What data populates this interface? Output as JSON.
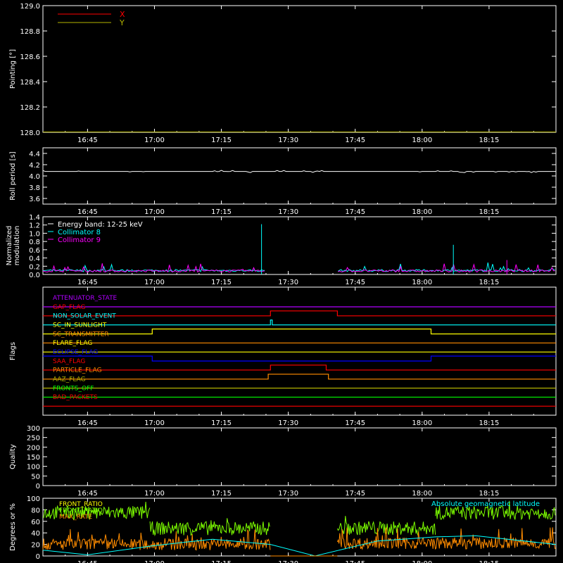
{
  "colors": {
    "background": "#000000",
    "axes": "#ffffff",
    "red": "#ff0000",
    "olive": "#b4b400",
    "cyan": "#00ffff",
    "magenta": "#ff00ff",
    "purple": "#b000ff",
    "orange": "#ff8c00",
    "yellow": "#ffff00",
    "blue": "#0000ff",
    "green": "#00ff00",
    "lightgreen": "#7cfc00"
  },
  "chart_data": [
    {
      "id": "pointing",
      "type": "line",
      "ylabel": "Pointing [°]",
      "ylim": [
        128.0,
        129.0
      ],
      "yticks": [
        "128.0",
        "128.2",
        "128.4",
        "128.6",
        "128.8",
        "129.0"
      ],
      "xticks": [
        "16:45",
        "17:00",
        "17:15",
        "17:30",
        "17:45",
        "18:00",
        "18:15"
      ],
      "series": [
        {
          "name": "X",
          "color": "red",
          "values": []
        },
        {
          "name": "Y",
          "color": "olive",
          "values": []
        }
      ]
    },
    {
      "id": "roll",
      "type": "line",
      "ylabel": "Roll period [s]",
      "ylim": [
        3.5,
        4.5
      ],
      "yticks": [
        "3.6",
        "3.8",
        "4.0",
        "4.2",
        "4.4"
      ],
      "xticks": [
        "16:45",
        "17:00",
        "17:15",
        "17:30",
        "17:45",
        "18:00",
        "18:15"
      ],
      "series": [
        {
          "name": "",
          "color": "axes",
          "level": 4.08
        }
      ]
    },
    {
      "id": "modulation",
      "type": "line",
      "ylabel": [
        "Normalized",
        "modulation"
      ],
      "ylim": [
        0,
        1.4
      ],
      "yticks": [
        "0.0",
        "0.2",
        "0.4",
        "0.6",
        "0.8",
        "1.0",
        "1.2",
        "1.4"
      ],
      "xticks": [
        "16:45",
        "17:00",
        "17:15",
        "17:30",
        "17:45",
        "18:00",
        "18:15"
      ],
      "legend": [
        "Energy band: 12-25 keV",
        "Collimator 8",
        "Collimator 9"
      ],
      "gaps": [
        [
          "17:25",
          "17:41"
        ]
      ],
      "spikes": [
        {
          "time": "17:24",
          "value": 1.22
        },
        {
          "time": "18:07",
          "value": 0.72
        },
        {
          "time": "18:19",
          "value": 0.35
        }
      ],
      "series": [
        {
          "name": "Collimator 8",
          "color": "cyan",
          "level": 0.07
        },
        {
          "name": "Collimator 9",
          "color": "magenta",
          "level": 0.06
        }
      ]
    },
    {
      "id": "flags",
      "type": "line",
      "ylabel": "Flags",
      "xticks": [
        "16:45",
        "17:00",
        "17:15",
        "17:30",
        "17:45",
        "18:00",
        "18:15"
      ],
      "flags": [
        {
          "name": "ATTENUATOR_STATE",
          "color": "purple",
          "on": []
        },
        {
          "name": "GAP_FLAG",
          "color": "red",
          "on": [
            [
              "17:26",
              "17:41"
            ]
          ]
        },
        {
          "name": "NON_SOLAR_EVENT",
          "color": "cyan",
          "on": [
            [
              "17:26",
              "17:26.4"
            ]
          ]
        },
        {
          "name": "SC_IN_SUNLIGHT",
          "color": "yellow",
          "on": [
            [
              "16:59.5",
              "18:02"
            ]
          ]
        },
        {
          "name": "SC_TRANSMITTER",
          "color": "orange",
          "on": []
        },
        {
          "name": "FLARE_FLAG",
          "color": "yellow",
          "on": []
        },
        {
          "name": "ECLIPSE_FLAG",
          "color": "blue",
          "on": [
            [
              "16:35",
              "16:59.5"
            ],
            [
              "18:02",
              "18:30"
            ]
          ]
        },
        {
          "name": "SAA_FLAG",
          "color": "red",
          "on": [
            [
              "17:26",
              "17:38.5"
            ]
          ]
        },
        {
          "name": "PARTICLE_FLAG",
          "color": "orange",
          "on": [
            [
              "17:25.5",
              "17:39"
            ]
          ]
        },
        {
          "name": "AAZ_FLAG",
          "color": "olive",
          "on": []
        },
        {
          "name": "FRONTS_OFF",
          "color": "green",
          "on": []
        },
        {
          "name": "BAD_PACKETS",
          "color": "red",
          "on": []
        }
      ]
    },
    {
      "id": "quality",
      "type": "line",
      "ylabel": "Quality",
      "ylim": [
        0,
        300
      ],
      "yticks": [
        "0",
        "50",
        "100",
        "150",
        "200",
        "250",
        "300"
      ],
      "xticks": [
        "16:45",
        "17:00",
        "17:15",
        "17:30",
        "17:45",
        "18:00",
        "18:15"
      ],
      "series": [
        {
          "name": "",
          "color": "axes",
          "values": []
        }
      ]
    },
    {
      "id": "ratios",
      "type": "line",
      "ylabel": "Degrees or %",
      "ylim": [
        0,
        100
      ],
      "yticks": [
        "0",
        "20",
        "40",
        "60",
        "80",
        "100"
      ],
      "xticks": [
        "16:45",
        "17:00",
        "17:15",
        "17:30",
        "17:45",
        "18:00",
        "18:15"
      ],
      "legend_left": [
        "FRONT_RATIO",
        "FRONT_RATIO",
        "MAX_RATE"
      ],
      "legend_right": "Absolute geomagnetic latitude",
      "series": [
        {
          "name": "FRONT_RATIO",
          "color": "lightgreen",
          "segments": [
            [
              "16:35",
              "16:59",
              75
            ],
            [
              "16:59",
              "17:26",
              48
            ],
            [
              "17:41",
              "18:03",
              48
            ],
            [
              "18:03",
              "18:30",
              75
            ]
          ]
        },
        {
          "name": "MAX_RATE",
          "color": "orange",
          "segments": [
            [
              "16:35",
              "17:26",
              20
            ],
            [
              "17:41",
              "18:30",
              22
            ]
          ]
        },
        {
          "name": "Absolute geomagnetic latitude",
          "color": "cyan",
          "profile": [
            [
              "16:35",
              10
            ],
            [
              "16:45",
              2
            ],
            [
              "17:00",
              18
            ],
            [
              "17:13",
              29
            ],
            [
              "17:26",
              20
            ],
            [
              "17:36",
              0
            ],
            [
              "17:50",
              26
            ],
            [
              "18:03",
              33
            ],
            [
              "18:12",
              35
            ],
            [
              "18:30",
              20
            ]
          ]
        }
      ]
    }
  ]
}
